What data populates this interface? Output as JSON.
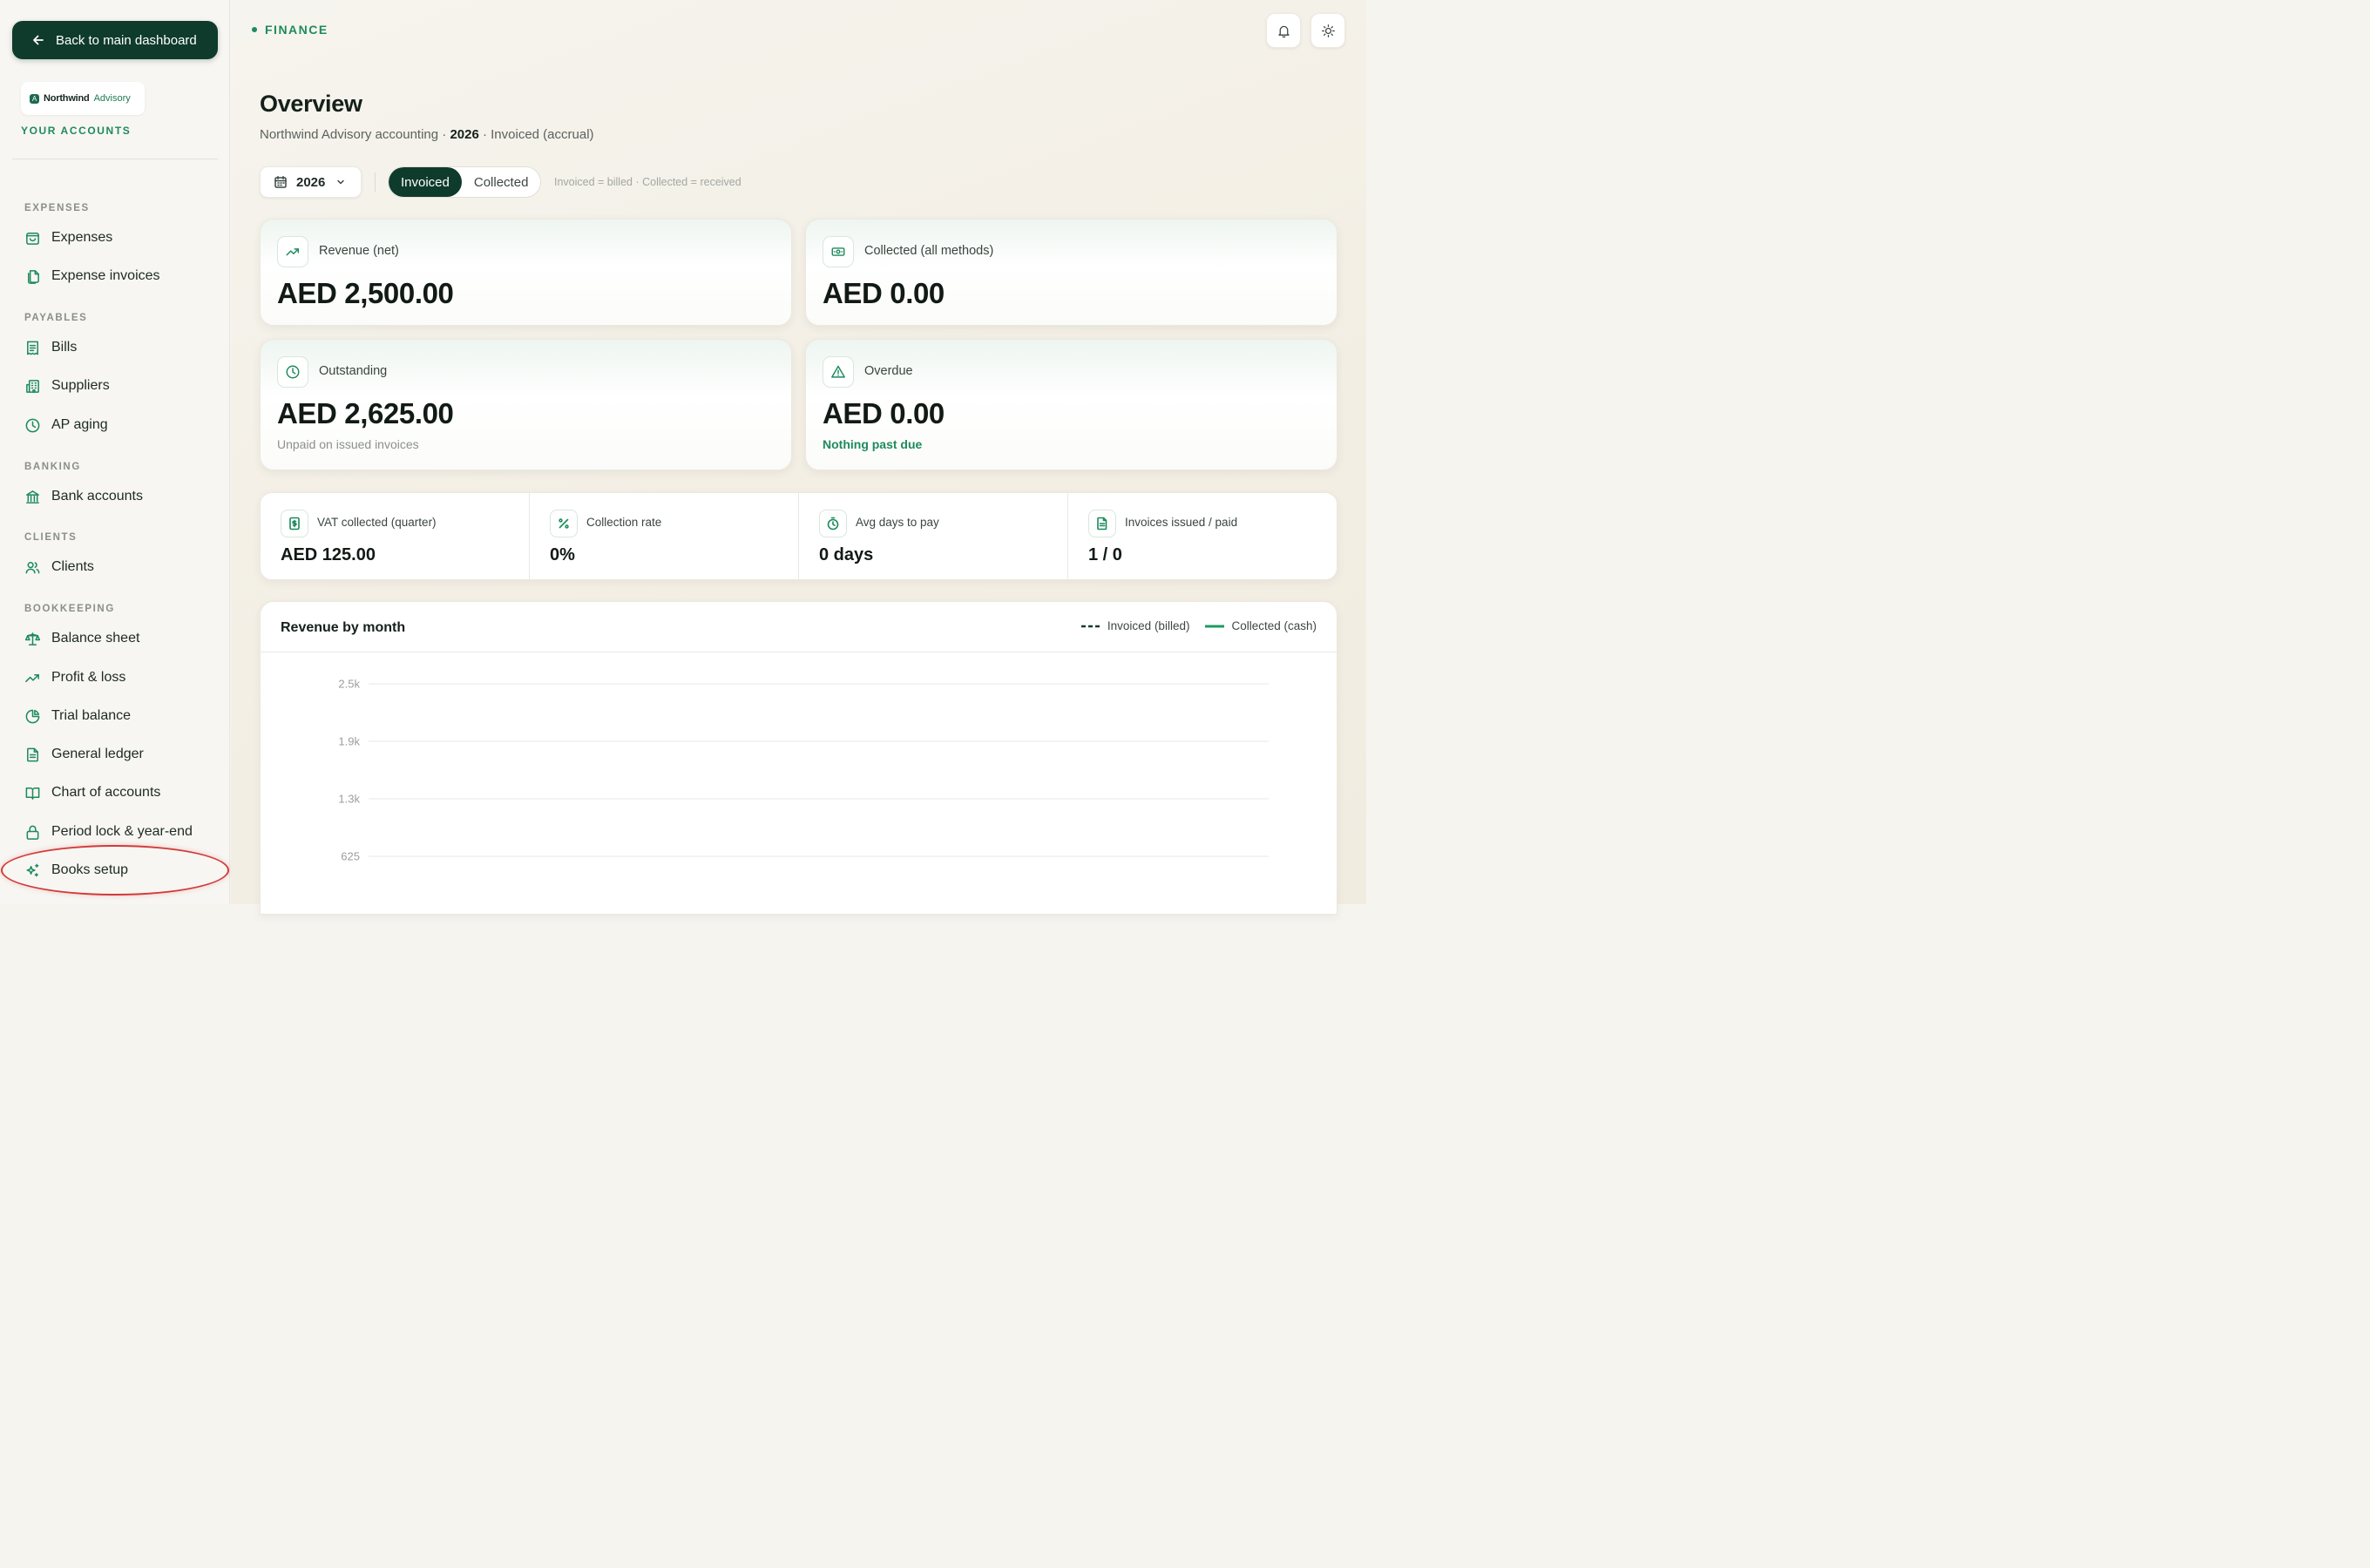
{
  "sidebar": {
    "back_label": "Back to main dashboard",
    "org": {
      "logo_letter": "A",
      "name": "Northwind",
      "suffix": "Advisory"
    },
    "accounts_label": "YOUR ACCOUNTS",
    "sections": [
      {
        "label": "EXPENSES",
        "items": [
          {
            "label": "Expenses",
            "icon": "wallet-icon"
          },
          {
            "label": "Expense invoices",
            "icon": "copy-doc-icon"
          }
        ]
      },
      {
        "label": "PAYABLES",
        "items": [
          {
            "label": "Bills",
            "icon": "receipt-icon"
          },
          {
            "label": "Suppliers",
            "icon": "building-icon"
          },
          {
            "label": "AP aging",
            "icon": "clock-icon"
          }
        ]
      },
      {
        "label": "BANKING",
        "items": [
          {
            "label": "Bank accounts",
            "icon": "bank-icon"
          }
        ]
      },
      {
        "label": "CLIENTS",
        "items": [
          {
            "label": "Clients",
            "icon": "users-icon"
          }
        ]
      },
      {
        "label": "BOOKKEEPING",
        "items": [
          {
            "label": "Balance sheet",
            "icon": "scale-icon"
          },
          {
            "label": "Profit & loss",
            "icon": "trend-up-icon"
          },
          {
            "label": "Trial balance",
            "icon": "pie-icon"
          },
          {
            "label": "General ledger",
            "icon": "doc-lines-icon"
          },
          {
            "label": "Chart of accounts",
            "icon": "book-icon"
          },
          {
            "label": "Period lock & year-end",
            "icon": "lock-icon"
          },
          {
            "label": "Books setup",
            "icon": "sparkles-icon"
          }
        ]
      }
    ]
  },
  "header": {
    "breadcrumb": "FINANCE"
  },
  "page": {
    "title": "Overview",
    "subtitle_prefix": "Northwind Advisory accounting · ",
    "subtitle_year": "2026",
    "subtitle_suffix": " · Invoiced (accrual)"
  },
  "controls": {
    "year": "2026",
    "toggle": {
      "active": "Invoiced",
      "inactive": "Collected"
    },
    "hint": "Invoiced = billed · Collected = received"
  },
  "kpis": {
    "revenue": {
      "label": "Revenue (net)",
      "value": "AED 2,500.00"
    },
    "collected": {
      "label": "Collected (all methods)",
      "value": "AED 0.00"
    },
    "outstanding": {
      "label": "Outstanding",
      "value": "AED 2,625.00",
      "note": "Unpaid on issued invoices"
    },
    "overdue": {
      "label": "Overdue",
      "value": "AED 0.00",
      "note": "Nothing past due"
    }
  },
  "stats": [
    {
      "label": "VAT collected (quarter)",
      "value": "AED 125.00",
      "icon": "dollar-doc-icon"
    },
    {
      "label": "Collection rate",
      "value": "0%",
      "icon": "percent-icon"
    },
    {
      "label": "Avg days to pay",
      "value": "0 days",
      "icon": "stopwatch-icon"
    },
    {
      "label": "Invoices issued / paid",
      "value": "1 / 0",
      "icon": "invoice-icon"
    }
  ],
  "colors": {
    "brand_dark": "#0f3b2c",
    "accent": "#1f8a5d",
    "highlight_ring": "#d23a3a"
  },
  "chart_data": {
    "type": "line",
    "title": "Revenue by month",
    "series": [
      {
        "name": "Invoiced (billed)",
        "style": "dashed",
        "color": "#173b2e",
        "values": []
      },
      {
        "name": "Collected (cash)",
        "style": "solid",
        "color": "#1f9a63",
        "values": []
      }
    ],
    "y_ticks": [
      "2.5k",
      "1.9k",
      "1.3k",
      "625"
    ],
    "y_tick_values": [
      2500,
      1875,
      1250,
      625
    ],
    "ylim": [
      0,
      2500
    ],
    "grid": true,
    "legend_position": "top-right"
  }
}
